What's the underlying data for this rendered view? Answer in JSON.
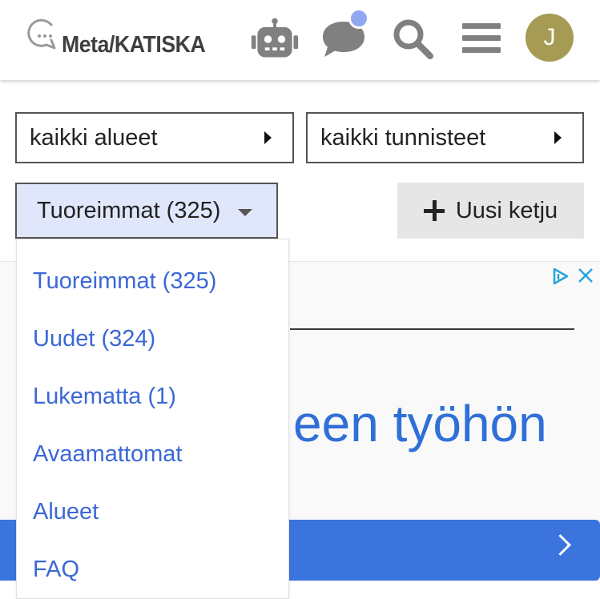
{
  "header": {
    "site_name": "Meta/KATISKA",
    "avatar_letter": "J",
    "icons": [
      "robot-icon",
      "chat-icon",
      "search-icon",
      "hamburger-menu-icon"
    ],
    "notification_color": "#8fa8ef",
    "avatar_color": "#a69b54"
  },
  "filters": {
    "category_label": "kaikki alueet",
    "tag_label": "kaikki tunnisteet"
  },
  "nav": {
    "current_label": "Tuoreimmat (325)",
    "new_topic_label": "Uusi ketju",
    "menu_items": [
      "Tuoreimmat (325)",
      "Uudet (324)",
      "Lukematta (1)",
      "Avaamattomat",
      "Alueet",
      "FAQ"
    ]
  },
  "ad": {
    "text": "een työhön",
    "accent_color": "#3b74dd"
  },
  "colors": {
    "link": "#3b68d6",
    "nav_button_bg": "#e1e7fb"
  }
}
